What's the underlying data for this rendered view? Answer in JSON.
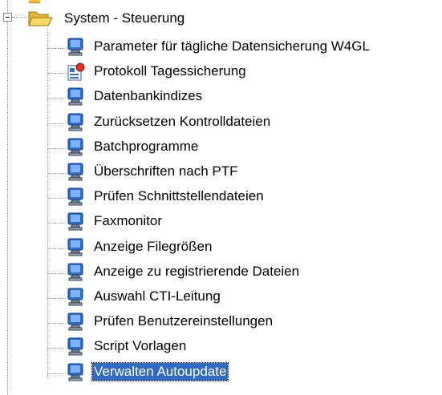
{
  "tree": {
    "root": {
      "label": "System - Steuerung",
      "expanded": true,
      "icon": "open-folder-icon"
    },
    "items": [
      {
        "label": "Parameter für tägliche Datensicherung W4GL",
        "icon": "monitor-icon",
        "selected": false
      },
      {
        "label": "Protokoll Tagessicherung",
        "icon": "report-icon",
        "selected": false
      },
      {
        "label": "Datenbankindizes",
        "icon": "monitor-icon",
        "selected": false
      },
      {
        "label": "Zurücksetzen Kontrolldateien",
        "icon": "monitor-icon",
        "selected": false
      },
      {
        "label": "Batchprogramme",
        "icon": "monitor-icon",
        "selected": false
      },
      {
        "label": "Überschriften nach PTF",
        "icon": "monitor-icon",
        "selected": false
      },
      {
        "label": "Prüfen Schnittstellendateien",
        "icon": "monitor-icon",
        "selected": false
      },
      {
        "label": "Faxmonitor",
        "icon": "monitor-icon",
        "selected": false
      },
      {
        "label": "Anzeige Filegrößen",
        "icon": "monitor-icon",
        "selected": false
      },
      {
        "label": "Anzeige zu registrierende Dateien",
        "icon": "monitor-icon",
        "selected": false
      },
      {
        "label": "Auswahl CTI-Leitung",
        "icon": "monitor-icon",
        "selected": false
      },
      {
        "label": "Prüfen Benutzereinstellungen",
        "icon": "monitor-icon",
        "selected": false
      },
      {
        "label": "Script Vorlagen",
        "icon": "monitor-icon",
        "selected": false
      },
      {
        "label": "Verwalten Autoupdate",
        "icon": "monitor-icon",
        "selected": true
      }
    ],
    "colors": {
      "selection": "#316ac5",
      "selection_text": "#ffffff",
      "guide_line": "#a0a0a0",
      "monitor_blue": "#2a6fd6",
      "folder_yellow": "#f0c040"
    }
  }
}
